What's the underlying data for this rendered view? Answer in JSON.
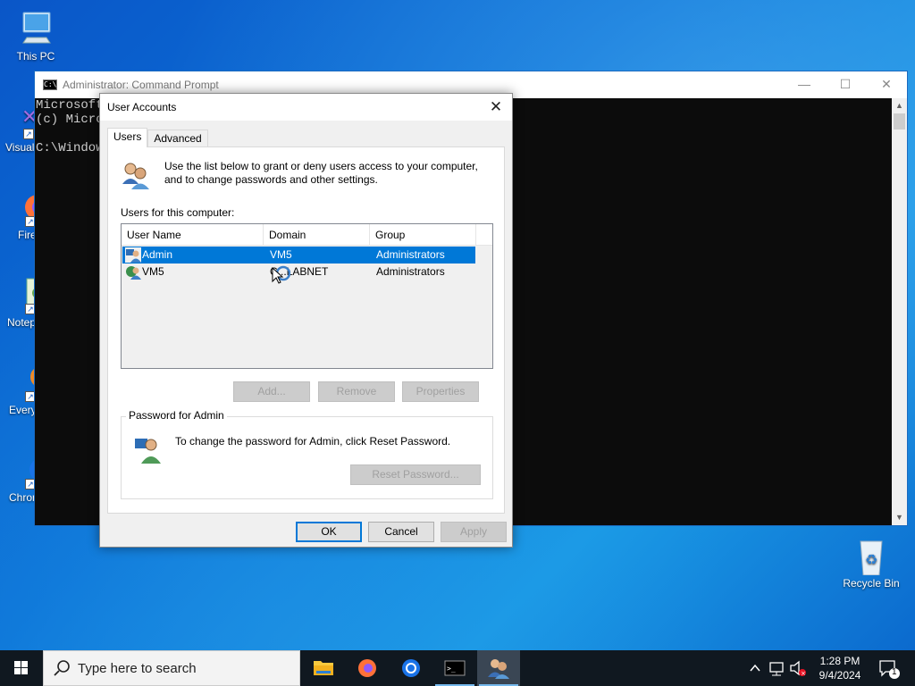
{
  "desktop": {
    "icons": [
      {
        "label": "This PC"
      },
      {
        "label": "Visual"
      },
      {
        "label": "Fire"
      },
      {
        "label": "Notep"
      },
      {
        "label": "Every"
      },
      {
        "label": "Chron"
      },
      {
        "label": "Recycle Bin"
      }
    ]
  },
  "cmd": {
    "title": "Administrator: Command Prompt",
    "lines": [
      "Microsoft",
      "(c) Micro",
      "",
      "C:\\Window"
    ],
    "minimize": "—",
    "maximize": "☐",
    "close": "✕"
  },
  "dialog": {
    "title": "User Accounts",
    "close": "✕",
    "tabs": [
      {
        "label": "Users"
      },
      {
        "label": "Advanced"
      }
    ],
    "intro": "Use the list below to grant or deny users access to your computer, and to change passwords and other settings.",
    "users_label": "Users for this computer:",
    "columns": [
      "User Name",
      "Domain",
      "Group"
    ],
    "rows": [
      {
        "name": "Admin",
        "domain": "VM5",
        "group": "Administrators",
        "selected": true
      },
      {
        "name": "VM5",
        "domain": "C...LABNET",
        "group": "Administrators",
        "selected": false
      }
    ],
    "buttons": {
      "add": "Add...",
      "remove": "Remove",
      "properties": "Properties"
    },
    "password_group": "Password for Admin",
    "password_text": "To change the password for Admin, click Reset Password.",
    "reset_password": "Reset Password...",
    "ok": "OK",
    "cancel": "Cancel",
    "apply": "Apply"
  },
  "taskbar": {
    "search_placeholder": "Type here to search",
    "time": "1:28 PM",
    "date": "9/4/2024",
    "notification_count": "1"
  },
  "colors": {
    "selection": "#0078d7",
    "taskbar": "#101820",
    "desktop": "#0b74d8"
  }
}
